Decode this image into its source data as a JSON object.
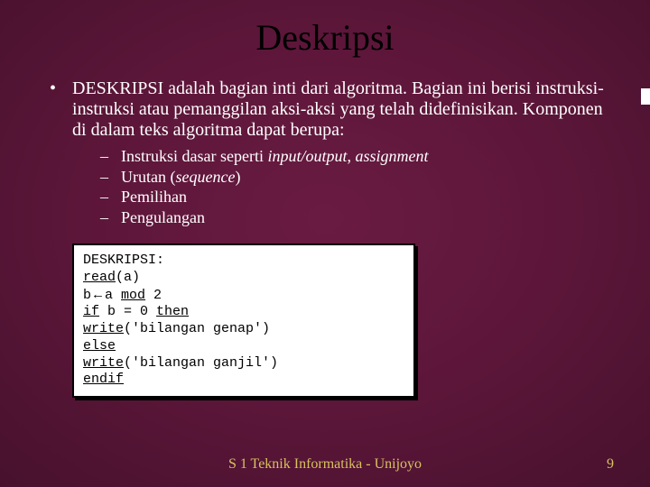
{
  "title": "Deskripsi",
  "main": {
    "text": "DESKRIPSI adalah bagian inti dari algoritma. Bagian ini berisi instruksi-instruksi atau pemanggilan aksi-aksi yang telah didefinisikan. Komponen di dalam teks algoritma dapat berupa:"
  },
  "sub": {
    "items": [
      {
        "pre": "Instruksi dasar seperti ",
        "em": "input/output",
        "mid": ", ",
        "em2": "assignment",
        "post": ""
      },
      {
        "pre": "Urutan (",
        "em": "sequence",
        "mid": "",
        "em2": "",
        "post": ")"
      },
      {
        "pre": "Pemilihan",
        "em": "",
        "mid": "",
        "em2": "",
        "post": ""
      },
      {
        "pre": "Pengulangan",
        "em": "",
        "mid": "",
        "em2": "",
        "post": ""
      }
    ]
  },
  "code": {
    "l1a": "DESKRIPSI:",
    "l2u": "read",
    "l2b": "(a)",
    "l3a": "b",
    "l3arrow": "←",
    "l3b": "a ",
    "l3u": "mod",
    "l3c": " 2",
    "l4u1": "if",
    "l4a": " b = 0 ",
    "l4u2": "then",
    "l5u": "write",
    "l5a": "('bilangan genap')",
    "l6u": "else",
    "l7u": "write",
    "l7a": "('bilangan ganjil')",
    "l8u": "endif"
  },
  "footer": "S 1 Teknik Informatika - Unijoyo",
  "page": "9"
}
